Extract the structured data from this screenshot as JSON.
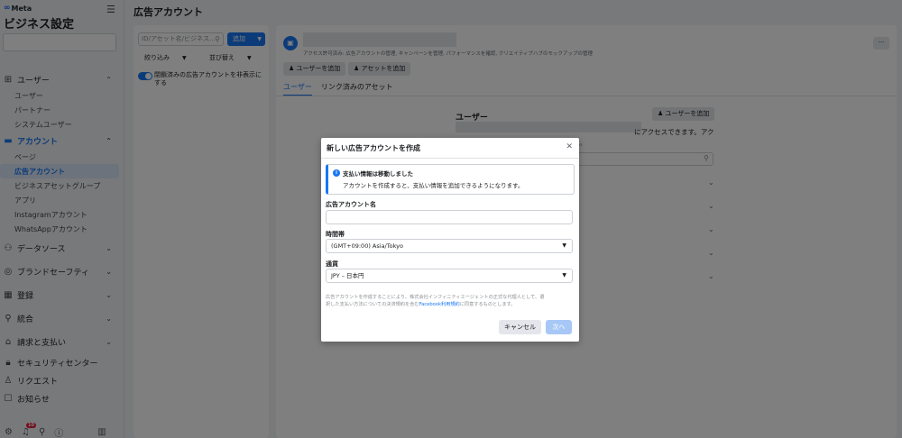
{
  "sidebar": {
    "logo": "Meta",
    "title": "ビジネス設定",
    "nav": [
      {
        "label": "ユーザー",
        "sub": [
          "ユーザー",
          "パートナー",
          "システムユーザー"
        ]
      },
      {
        "label": "アカウント",
        "sub": [
          "ページ",
          "広告アカウント",
          "ビジネスアセットグループ",
          "アプリ",
          "Instagramアカウント",
          "WhatsAppアカウント"
        ]
      },
      {
        "label": "データソース"
      },
      {
        "label": "ブランドセーフティ"
      },
      {
        "label": "登録"
      },
      {
        "label": "統合"
      },
      {
        "label": "請求と支払い"
      },
      {
        "label": "セキュリティセンター"
      },
      {
        "label": "リクエスト"
      },
      {
        "label": "お知らせ"
      }
    ],
    "notification_count": "10"
  },
  "main": {
    "page_title": "広告アカウント",
    "search_placeholder": "ID/アセット名/ビジネス...",
    "add_label": "追加",
    "filter_label": "絞り込み",
    "sort_label": "並び替え",
    "toggle_label": "閉鎖済みの広告アカウントを非表示にする",
    "account_desc": "アクセス許可済み: 広告アカウントの管理, キャンペーンを管理, パフォーマンスを確認, クリエイティブハブのモックアップの管理",
    "add_user_label": "ユーザーを追加",
    "add_asset_label": "アセットを追加",
    "tabs": [
      "ユーザー",
      "リンク済みのアセット"
    ],
    "users_heading": "ユーザー",
    "users_add_label": "ユーザーを追加",
    "fragment_1": "にアクセスできます。アク",
    "fragment_2": "できます。"
  },
  "modal": {
    "title": "新しい広告アカウントを作成",
    "info_title": "支払い情報は移動しました",
    "info_text": "アカウントを作成すると、支払い情報を追加できるようになります。",
    "name_label": "広告アカウント名",
    "name_value": "",
    "timezone_label": "時間帯",
    "timezone_value": "(GMT+09:00) Asia/Tokyo",
    "currency_label": "通貨",
    "currency_value": "JPY – 日本円",
    "legal_line1": "広告アカウントを作成することにより、株式会社インフィニティエージェントの正式な代理人として、選",
    "legal_line2_pre": "択した支払い方法についての決済規約を含む",
    "legal_link": "Facebook利用規約",
    "legal_line2_post": "に同意するものとします。",
    "cancel_label": "キャンセル",
    "next_label": "次へ"
  }
}
